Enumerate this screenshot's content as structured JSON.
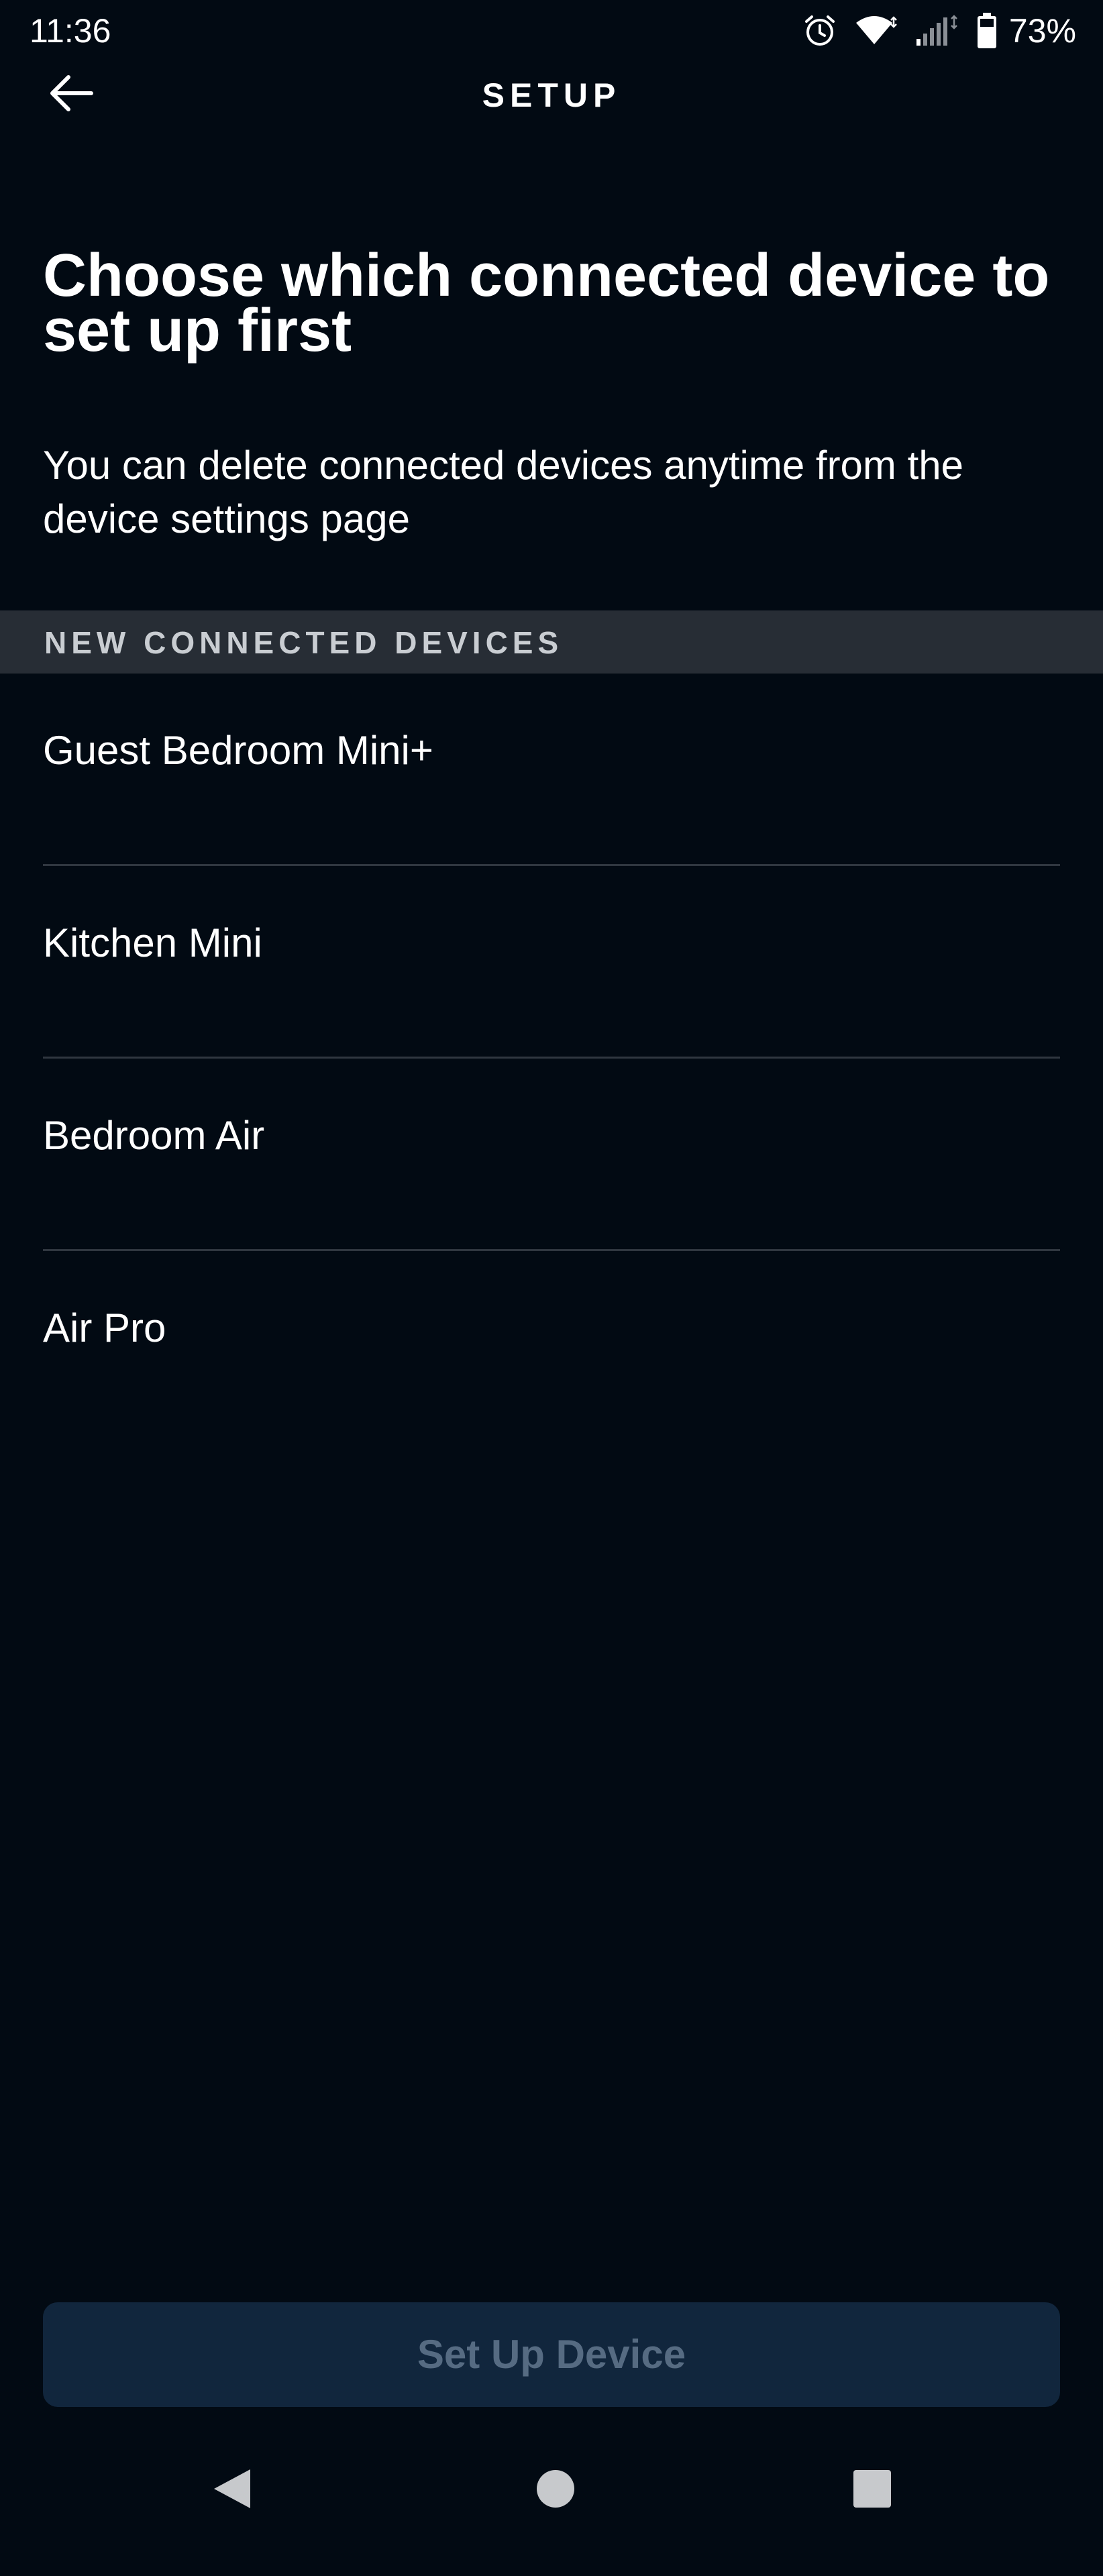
{
  "status_bar": {
    "time": "11:36",
    "battery_percent": "73%",
    "icons": [
      "alarm-icon",
      "wifi-icon",
      "cell-signal-icon",
      "battery-icon"
    ]
  },
  "app_bar": {
    "title": "SETUP",
    "back_icon": "arrow-left-icon"
  },
  "main": {
    "heading": "Choose which connected device to set up first",
    "subheading": "You can delete connected devices anytime from the device settings page",
    "section_title": "NEW CONNECTED DEVICES",
    "devices": [
      {
        "label": "Guest Bedroom Mini+"
      },
      {
        "label": "Kitchen Mini"
      },
      {
        "label": "Bedroom Air"
      },
      {
        "label": "Air Pro"
      }
    ],
    "primary_button": "Set Up Device"
  },
  "nav_bar": {
    "icons": [
      "nav-back-icon",
      "nav-home-icon",
      "nav-recents-icon"
    ]
  },
  "colors": {
    "background": "#020a13",
    "section_header_bg": "#272d35",
    "button_bg": "#11263d",
    "button_text_disabled": "#566b82",
    "divider": "#303740"
  }
}
